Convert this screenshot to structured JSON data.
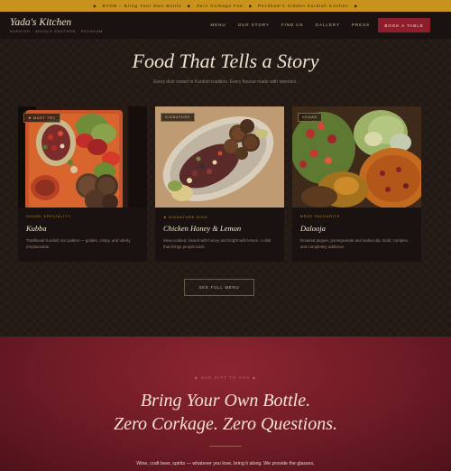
{
  "announcement": {
    "items": [
      "BYOB – Bring Your Own Bottle",
      "Zero Corkage Fee",
      "Peckham's Hidden Kurdish Kitchen"
    ],
    "separator": "◆"
  },
  "nav": {
    "logo": "Yada's Kitchen",
    "tagline": "KURDISH · MIDDLE EASTERN · PECKHAM",
    "links": [
      "MENU",
      "OUR STORY",
      "FIND US",
      "GALLERY",
      "PRESS"
    ],
    "cta": "BOOK A TABLE"
  },
  "menu_section": {
    "title": "Food That Tells a Story",
    "subtitle": "Every dish rooted in Kurdish tradition. Every flavour made with intention.",
    "cards": [
      {
        "badge": "★ MUST TRY",
        "kicker": "HOUSE SPECIALITY",
        "name": "Kubba",
        "description": "Traditional Kurdish rice patties — golden, crispy, and utterly irreplaceable.",
        "image_icon": "kubba-plate-photo"
      },
      {
        "badge": "SIGNATURE",
        "kicker": "★ SIGNATURE DISH",
        "name": "Chicken Honey & Lemon",
        "description": "Slow-cooked, kissed with honey and bright with lemon. A dish that brings people back.",
        "image_icon": "chicken-plate-photo"
      },
      {
        "badge": "VEGAN",
        "kicker": "MEZE FAVOURITE",
        "name": "Dalooja",
        "description": "Roasted pepper, pomegranate and walnut dip. Bold, complex, and completely addictive.",
        "image_icon": "dalooja-plate-photo"
      }
    ],
    "cta": "SEE FULL MENU"
  },
  "byob": {
    "eyebrow": "◆    OUR GIFT TO YOU    ◆",
    "line1": "Bring Your Own Bottle.",
    "line2": "Zero Corkage. Zero Questions.",
    "body": "Wine, craft beer, spirits — whatever you love, bring it along. We provide the glasses,"
  },
  "colors": {
    "announcement_bg": "#c8921d",
    "cta_bg": "#8e1d2c",
    "accent_gold": "#c08a1f",
    "byob_bg": "#7a1f2a"
  }
}
